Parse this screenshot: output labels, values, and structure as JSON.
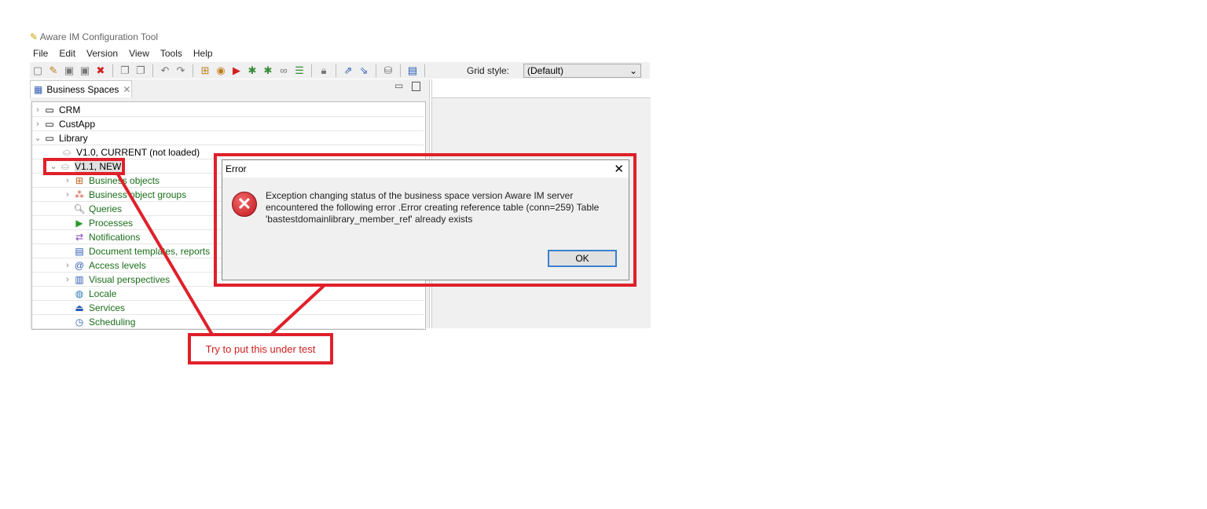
{
  "window": {
    "title": "Aware IM Configuration Tool"
  },
  "menu": [
    "File",
    "Edit",
    "Version",
    "View",
    "Tools",
    "Help"
  ],
  "toolbar": {
    "grid_style_label": "Grid style:",
    "grid_style_value": "(Default)"
  },
  "panel": {
    "tab_label": "Business Spaces"
  },
  "tree": {
    "spaces": [
      "CRM",
      "CustApp",
      "Library"
    ],
    "versions": [
      "V1.0, CURRENT (not loaded)",
      "V1.1, NEW"
    ],
    "items": [
      "Business objects",
      "Business object groups",
      "Queries",
      "Processes",
      "Notifications",
      "Document templates, reports",
      "Access levels",
      "Visual perspectives",
      "Locale",
      "Services",
      "Scheduling"
    ]
  },
  "dialog": {
    "title": "Error",
    "message": "Exception changing status of the business space version Aware IM server encountered the following error .Error creating reference table (conn=259) Table 'bastestdomainlibrary_member_ref' already exists",
    "ok_label": "OK"
  },
  "annotation": {
    "text": "Try to put this under test",
    "color": "#e0202a"
  }
}
